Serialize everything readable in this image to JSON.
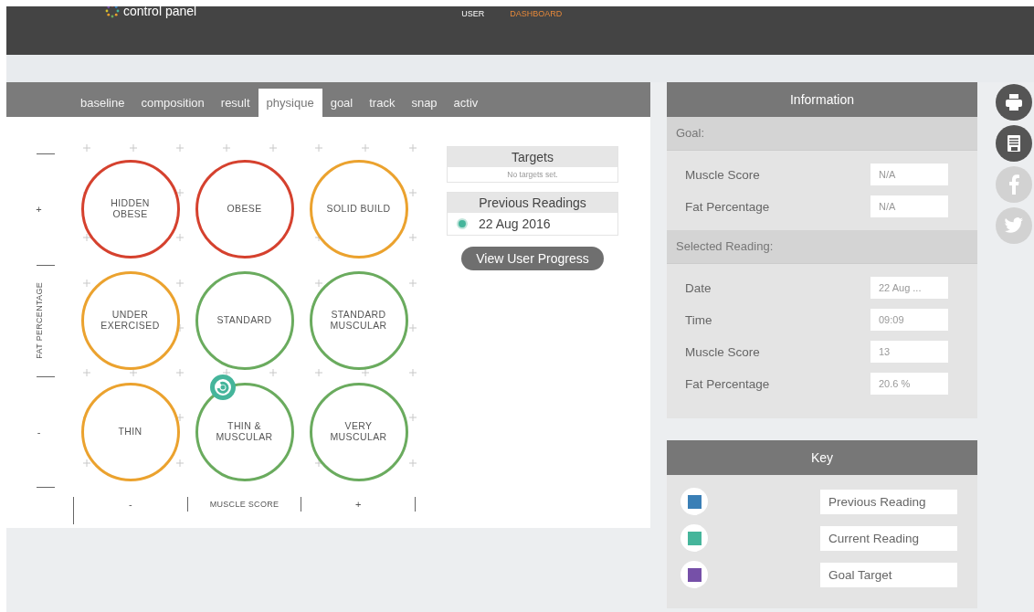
{
  "header": {
    "logo_text": "control panel",
    "nav": [
      {
        "label": "USER",
        "selected": false
      },
      {
        "label": "DASHBOARD",
        "selected": true
      }
    ]
  },
  "tabs": [
    {
      "label": "baseline",
      "selected": false
    },
    {
      "label": "composition",
      "selected": false
    },
    {
      "label": "result",
      "selected": false
    },
    {
      "label": "physique",
      "selected": true
    },
    {
      "label": "goal",
      "selected": false
    },
    {
      "label": "track",
      "selected": false
    },
    {
      "label": "snap",
      "selected": false
    },
    {
      "label": "activ",
      "selected": false
    }
  ],
  "matrix": {
    "y_axis": {
      "high": "+",
      "label": "FAT PERCENTAGE",
      "low": "-"
    },
    "x_axis": {
      "low": "-",
      "label": "MUSCLE SCORE",
      "high": "+"
    },
    "cells": [
      {
        "label": "HIDDEN\nOBESE",
        "color": "#d5412e",
        "current": false
      },
      {
        "label": "OBESE",
        "color": "#d5412e",
        "current": false
      },
      {
        "label": "SOLID BUILD",
        "color": "#eba22e",
        "current": false
      },
      {
        "label": "UNDER\nEXERCISED",
        "color": "#eba22e",
        "current": false
      },
      {
        "label": "STANDARD",
        "color": "#6aab5e",
        "current": false
      },
      {
        "label": "STANDARD\nMUSCULAR",
        "color": "#6aab5e",
        "current": false
      },
      {
        "label": "THIN",
        "color": "#eba22e",
        "current": false
      },
      {
        "label": "THIN &\nMUSCULAR",
        "color": "#6aab5e",
        "current": true
      },
      {
        "label": "VERY\nMUSCULAR",
        "color": "#6aab5e",
        "current": false
      }
    ]
  },
  "targets": {
    "title": "Targets",
    "empty_text": "No targets set."
  },
  "previous_readings": {
    "title": "Previous Readings",
    "items": [
      {
        "label": "22 Aug 2016",
        "selected": true
      }
    ]
  },
  "progress_button": "View User Progress",
  "information": {
    "title": "Information",
    "sections": [
      {
        "title": "Goal:",
        "rows": [
          {
            "label": "Muscle Score",
            "value": "N/A"
          },
          {
            "label": "Fat Percentage",
            "value": "N/A"
          }
        ]
      },
      {
        "title": "Selected Reading:",
        "rows": [
          {
            "label": "Date",
            "value": "22 Aug ..."
          },
          {
            "label": "Time",
            "value": "09:09"
          },
          {
            "label": "Muscle Score",
            "value": "13"
          },
          {
            "label": "Fat Percentage",
            "value": "20.6 %"
          }
        ]
      }
    ]
  },
  "key": {
    "title": "Key",
    "items": [
      {
        "label": "Previous Reading",
        "color": "#3a7fb6"
      },
      {
        "label": "Current Reading",
        "color": "#45b59b"
      },
      {
        "label": "Goal Target",
        "color": "#7650a8"
      }
    ]
  },
  "share_buttons": [
    {
      "kind": "print",
      "disabled": false
    },
    {
      "kind": "save",
      "disabled": false
    },
    {
      "kind": "facebook",
      "disabled": true
    },
    {
      "kind": "twitter",
      "disabled": true
    }
  ]
}
